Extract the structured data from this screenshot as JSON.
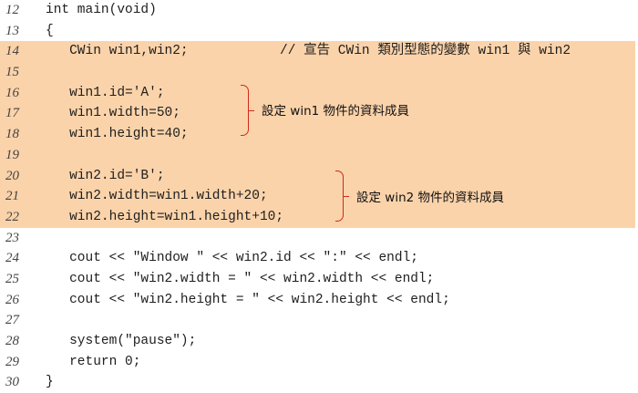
{
  "code_lines": [
    {
      "num": "12",
      "text": "int main(void)"
    },
    {
      "num": "13",
      "text": "{"
    },
    {
      "num": "14",
      "text": "   CWin win1,win2;",
      "comment": "// 宣告 CWin 類別型態的變數 win1 與 win2"
    },
    {
      "num": "15",
      "text": ""
    },
    {
      "num": "16",
      "text": "   win1.id='A';"
    },
    {
      "num": "17",
      "text": "   win1.width=50;"
    },
    {
      "num": "18",
      "text": "   win1.height=40;"
    },
    {
      "num": "19",
      "text": ""
    },
    {
      "num": "20",
      "text": "   win2.id='B';"
    },
    {
      "num": "21",
      "text": "   win2.width=win1.width+20;"
    },
    {
      "num": "22",
      "text": "   win2.height=win1.height+10;"
    },
    {
      "num": "23",
      "text": ""
    },
    {
      "num": "24",
      "text": "   cout << \"Window \" << win2.id << \":\" << endl;"
    },
    {
      "num": "25",
      "text": "   cout << \"win2.width = \" << win2.width << endl;"
    },
    {
      "num": "26",
      "text": "   cout << \"win2.height = \" << win2.height << endl;"
    },
    {
      "num": "27",
      "text": ""
    },
    {
      "num": "28",
      "text": "   system(\"pause\");"
    },
    {
      "num": "29",
      "text": "   return 0;"
    },
    {
      "num": "30",
      "text": "}"
    }
  ],
  "highlight_lines": [
    "14",
    "15",
    "16",
    "17",
    "18",
    "19",
    "20",
    "21",
    "22"
  ],
  "annotations": {
    "win1": "設定 win1 物件的資料成員",
    "win2": "設定 win2 物件的資料成員"
  },
  "colors": {
    "highlight": "#fbd3aa",
    "brace": "#d02a1a",
    "line_number": "#444444"
  }
}
